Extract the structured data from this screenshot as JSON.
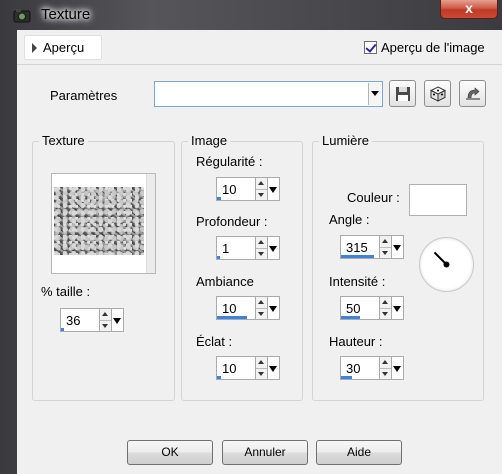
{
  "window": {
    "title": "Texture",
    "close_label": "x"
  },
  "preview_bar": {
    "toggle_label": "Aperçu",
    "checkbox_label": "Aperçu de l'image",
    "checkbox_checked": true
  },
  "presets": {
    "label": "Paramètres",
    "value": ""
  },
  "texture_group": {
    "title": "Texture",
    "size_label": "% taille :",
    "size_value": "36",
    "size_level": 0.02
  },
  "image_group": {
    "title": "Image",
    "fields": [
      {
        "label": "Régularité :",
        "value": "10",
        "level": 0.1
      },
      {
        "label": "Profondeur :",
        "value": "1",
        "level": 0.0
      },
      {
        "label": "Ambiance",
        "value": "10",
        "level": 0.8
      },
      {
        "label": "Éclat :",
        "value": "10",
        "level": 0.1
      }
    ]
  },
  "light_group": {
    "title": "Lumière",
    "color_label": "Couleur :",
    "color_value": "#ffffff",
    "angle_label": "Angle :",
    "angle_value": "315",
    "angle_level": 0.875,
    "intensity_label": "Intensité :",
    "intensity_value": "50",
    "intensity_level": 0.5,
    "height_label": "Hauteur :",
    "height_value": "30",
    "height_level": 0.3
  },
  "buttons": {
    "ok": "OK",
    "cancel": "Annuler",
    "help": "Aide"
  },
  "icons": {
    "app": "texture-app-icon",
    "save": "floppy-disk-icon",
    "randomize": "dice-icon",
    "reset": "reset-icon"
  }
}
